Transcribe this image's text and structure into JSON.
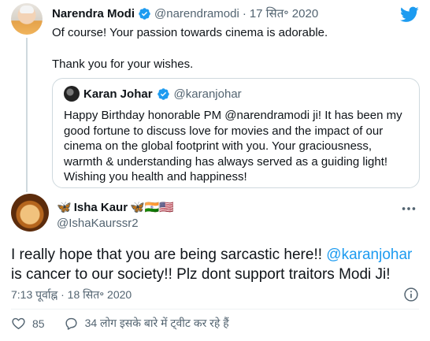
{
  "tweet1": {
    "author_name": "Narendra Modi",
    "author_handle": "@narendramodi",
    "separator": "·",
    "date": "17 सित॰ 2020",
    "text_line1": "Of course! Your passion towards cinema is adorable.",
    "text_line2": "Thank you for your wishes."
  },
  "quoted_tweet": {
    "author_name": "Karan Johar",
    "author_handle": "@karanjohar",
    "text": "Happy Birthday honorable PM @narendramodi ji! It has been my good fortune to discuss love for movies and the impact of our cinema on the global footprint with you. Your graciousness, warmth & understanding has always served as a guiding light! Wishing you health and happiness!"
  },
  "tweet2": {
    "author_name": "Isha Kaur",
    "author_name_emojis_prefix": "🦋",
    "author_name_emojis_suffix": "🦋🇮🇳🇺🇸",
    "author_handle": "@IshaKaurssr2",
    "text_before_mention": "I really hope that you are being sarcastic here!! ",
    "mention": "@karanjohar",
    "text_after_mention": " is cancer to our society!! Plz dont support traitors Modi Ji!",
    "time": "7:13 पूर्वाह्न",
    "separator": "·",
    "date": "18 सित॰ 2020",
    "like_count": "85",
    "reply_label": "34 लोग इसके बारे में ट्वीट कर रहे हैं"
  },
  "icons": {
    "verified": "verified-badge-icon",
    "brand": "twitter-bird-icon",
    "more": "more-options-icon",
    "info": "info-icon",
    "like": "heart-icon",
    "reply": "comment-icon"
  },
  "colors": {
    "accent": "#1d9bf0",
    "text": "#0f1419",
    "muted": "#536471",
    "border": "#cfd9de"
  }
}
